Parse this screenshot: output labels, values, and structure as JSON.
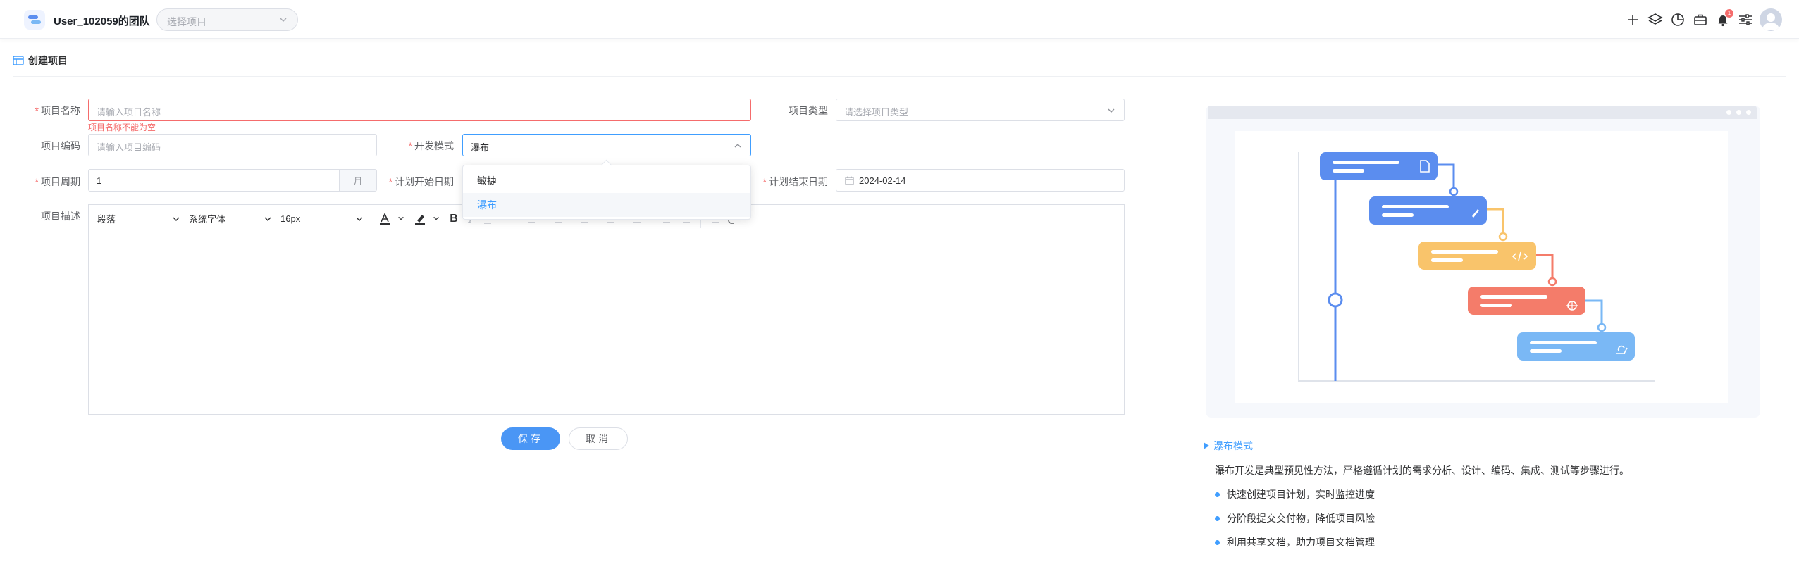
{
  "topbar": {
    "team_name": "User_102059的团队",
    "project_select_placeholder": "选择项目",
    "notification_count": "1"
  },
  "page": {
    "title": "创建项目"
  },
  "form": {
    "name_label": "项目名称",
    "name_placeholder": "请输入项目名称",
    "name_error": "项目名称不能为空",
    "type_label": "项目类型",
    "type_placeholder": "请选择项目类型",
    "code_label": "项目编码",
    "code_placeholder": "请输入项目编码",
    "dev_mode_label": "开发模式",
    "dev_mode_value": "瀑布",
    "dev_mode_options": [
      "敏捷",
      "瀑布"
    ],
    "period_label": "项目周期",
    "period_value": "1",
    "period_unit": "月",
    "start_label": "计划开始日期",
    "end_label": "计划结束日期",
    "end_value": "2024-02-14",
    "desc_label": "项目描述"
  },
  "editor": {
    "paragraph": "段落",
    "font": "系统字体",
    "size": "16px"
  },
  "actions": {
    "save": "保存",
    "cancel": "取消"
  },
  "info": {
    "mode_title": "瀑布模式",
    "description": "瀑布开发是典型预见性方法，严格遵循计划的需求分析、设计、编码、集成、测试等步骤进行。",
    "bullets": [
      "快速创建项目计划，实时监控进度",
      "分阶段提交交付物，降低项目风险",
      "利用共享文档，助力项目文档管理"
    ]
  },
  "colors": {
    "primary": "#409eff",
    "error": "#f56c6c",
    "stage_requirements": "#5b8def",
    "stage_design": "#5b8def",
    "stage_coding": "#f9c46b",
    "stage_testing": "#f47c6a",
    "stage_deploy": "#7ab8f5"
  }
}
